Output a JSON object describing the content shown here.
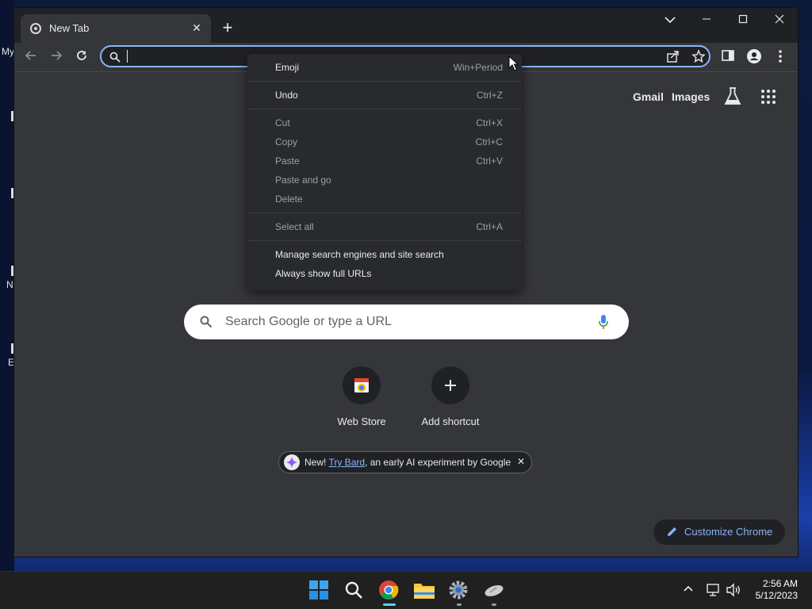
{
  "desktop": {
    "icon_fragments": [
      "My",
      "N",
      "E"
    ]
  },
  "browser": {
    "tab": {
      "title": "New Tab"
    },
    "window_controls": [
      "tab-search",
      "minimize",
      "maximize",
      "close"
    ],
    "omnibox": {
      "value": ""
    },
    "ntp": {
      "top_links": {
        "gmail": "Gmail",
        "images": "Images"
      },
      "search_placeholder": "Search Google or type a URL",
      "shortcuts": [
        {
          "label": "Web Store",
          "icon": "web-store-icon"
        },
        {
          "label": "Add shortcut",
          "icon": "plus-icon"
        }
      ],
      "promo": {
        "prefix": "New! ",
        "link": "Try Bard",
        "suffix": ", an early AI experiment by Google"
      },
      "customize_label": "Customize Chrome"
    }
  },
  "context_menu": {
    "items": [
      {
        "label": "Emoji",
        "shortcut": "Win+Period",
        "enabled": true
      },
      {
        "label": "Undo",
        "shortcut": "Ctrl+Z",
        "enabled": true
      },
      {
        "label": "Cut",
        "shortcut": "Ctrl+X",
        "enabled": false
      },
      {
        "label": "Copy",
        "shortcut": "Ctrl+C",
        "enabled": false
      },
      {
        "label": "Paste",
        "shortcut": "Ctrl+V",
        "enabled": false
      },
      {
        "label": "Paste and go",
        "shortcut": "",
        "enabled": false
      },
      {
        "label": "Delete",
        "shortcut": "",
        "enabled": false
      },
      {
        "label": "Select all",
        "shortcut": "Ctrl+A",
        "enabled": false
      },
      {
        "label": "Manage search engines and site search",
        "shortcut": "",
        "enabled": true
      },
      {
        "label": "Always show full URLs",
        "shortcut": "",
        "enabled": true
      }
    ]
  },
  "taskbar": {
    "apps": [
      "start-icon",
      "search-icon",
      "chrome-icon",
      "file-explorer-icon",
      "settings-icon",
      "mouse-icon"
    ],
    "clock": {
      "time": "2:56 AM",
      "date": "5/12/2023"
    }
  },
  "colors": {
    "accent": "#8ab4f8",
    "frame": "#202124",
    "surface": "#35363a"
  }
}
